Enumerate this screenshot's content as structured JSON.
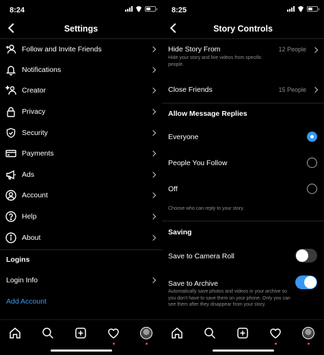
{
  "left": {
    "status": {
      "time": "8:24"
    },
    "title": "Settings",
    "items": [
      {
        "label": "Follow and Invite Friends",
        "icon": "add-person-icon"
      },
      {
        "label": "Notifications",
        "icon": "bell-icon"
      },
      {
        "label": "Creator",
        "icon": "creator-icon"
      },
      {
        "label": "Privacy",
        "icon": "lock-icon"
      },
      {
        "label": "Security",
        "icon": "shield-icon"
      },
      {
        "label": "Payments",
        "icon": "card-icon"
      },
      {
        "label": "Ads",
        "icon": "megaphone-icon"
      },
      {
        "label": "Account",
        "icon": "account-icon"
      },
      {
        "label": "Help",
        "icon": "help-icon"
      },
      {
        "label": "About",
        "icon": "info-icon"
      }
    ],
    "logins_header": "Logins",
    "login_info": "Login Info",
    "add_account": "Add Account"
  },
  "right": {
    "status": {
      "time": "8:25"
    },
    "title": "Story Controls",
    "hide_story": {
      "label": "Hide Story From",
      "value": "12 People",
      "desc": "Hide your story and live videos from specific people."
    },
    "close_friends": {
      "label": "Close Friends",
      "value": "15 People"
    },
    "replies_header": "Allow Message Replies",
    "reply_options": [
      {
        "label": "Everyone",
        "selected": true
      },
      {
        "label": "People You Follow",
        "selected": false
      },
      {
        "label": "Off",
        "selected": false
      }
    ],
    "reply_desc": "Choose who can reply to your story.",
    "saving_header": "Saving",
    "save_camera": {
      "label": "Save to Camera Roll",
      "on": false
    },
    "save_archive": {
      "label": "Save to Archive",
      "on": true,
      "desc": "Automatically save photos and videos in your archive so you don't have to save them on your phone. Only you can see them after they disappear from your story."
    }
  },
  "tabbar": [
    "home-icon",
    "search-icon",
    "new-post-icon",
    "heart-icon",
    "profile-avatar"
  ],
  "colors": {
    "accent": "#3897f0",
    "background": "#000000",
    "notification_dot": "#ed4956"
  }
}
